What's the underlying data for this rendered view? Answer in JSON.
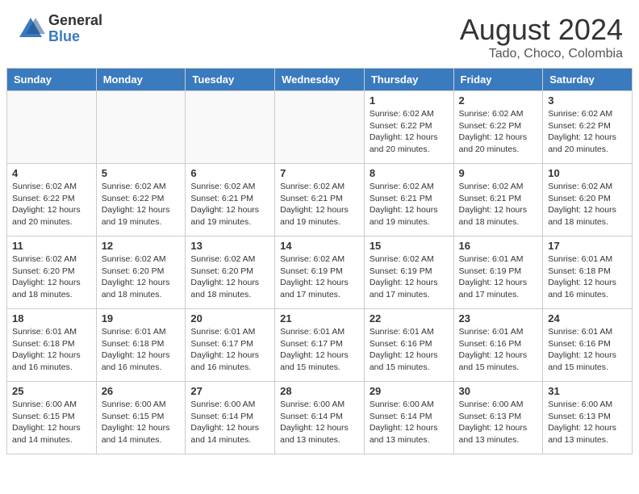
{
  "logo": {
    "general": "General",
    "blue": "Blue"
  },
  "header": {
    "month": "August 2024",
    "location": "Tado, Choco, Colombia"
  },
  "weekdays": [
    "Sunday",
    "Monday",
    "Tuesday",
    "Wednesday",
    "Thursday",
    "Friday",
    "Saturday"
  ],
  "weeks": [
    [
      {
        "day": "",
        "info": ""
      },
      {
        "day": "",
        "info": ""
      },
      {
        "day": "",
        "info": ""
      },
      {
        "day": "",
        "info": ""
      },
      {
        "day": "1",
        "info": "Sunrise: 6:02 AM\nSunset: 6:22 PM\nDaylight: 12 hours\nand 20 minutes."
      },
      {
        "day": "2",
        "info": "Sunrise: 6:02 AM\nSunset: 6:22 PM\nDaylight: 12 hours\nand 20 minutes."
      },
      {
        "day": "3",
        "info": "Sunrise: 6:02 AM\nSunset: 6:22 PM\nDaylight: 12 hours\nand 20 minutes."
      }
    ],
    [
      {
        "day": "4",
        "info": "Sunrise: 6:02 AM\nSunset: 6:22 PM\nDaylight: 12 hours\nand 20 minutes."
      },
      {
        "day": "5",
        "info": "Sunrise: 6:02 AM\nSunset: 6:22 PM\nDaylight: 12 hours\nand 19 minutes."
      },
      {
        "day": "6",
        "info": "Sunrise: 6:02 AM\nSunset: 6:21 PM\nDaylight: 12 hours\nand 19 minutes."
      },
      {
        "day": "7",
        "info": "Sunrise: 6:02 AM\nSunset: 6:21 PM\nDaylight: 12 hours\nand 19 minutes."
      },
      {
        "day": "8",
        "info": "Sunrise: 6:02 AM\nSunset: 6:21 PM\nDaylight: 12 hours\nand 19 minutes."
      },
      {
        "day": "9",
        "info": "Sunrise: 6:02 AM\nSunset: 6:21 PM\nDaylight: 12 hours\nand 18 minutes."
      },
      {
        "day": "10",
        "info": "Sunrise: 6:02 AM\nSunset: 6:20 PM\nDaylight: 12 hours\nand 18 minutes."
      }
    ],
    [
      {
        "day": "11",
        "info": "Sunrise: 6:02 AM\nSunset: 6:20 PM\nDaylight: 12 hours\nand 18 minutes."
      },
      {
        "day": "12",
        "info": "Sunrise: 6:02 AM\nSunset: 6:20 PM\nDaylight: 12 hours\nand 18 minutes."
      },
      {
        "day": "13",
        "info": "Sunrise: 6:02 AM\nSunset: 6:20 PM\nDaylight: 12 hours\nand 18 minutes."
      },
      {
        "day": "14",
        "info": "Sunrise: 6:02 AM\nSunset: 6:19 PM\nDaylight: 12 hours\nand 17 minutes."
      },
      {
        "day": "15",
        "info": "Sunrise: 6:02 AM\nSunset: 6:19 PM\nDaylight: 12 hours\nand 17 minutes."
      },
      {
        "day": "16",
        "info": "Sunrise: 6:01 AM\nSunset: 6:19 PM\nDaylight: 12 hours\nand 17 minutes."
      },
      {
        "day": "17",
        "info": "Sunrise: 6:01 AM\nSunset: 6:18 PM\nDaylight: 12 hours\nand 16 minutes."
      }
    ],
    [
      {
        "day": "18",
        "info": "Sunrise: 6:01 AM\nSunset: 6:18 PM\nDaylight: 12 hours\nand 16 minutes."
      },
      {
        "day": "19",
        "info": "Sunrise: 6:01 AM\nSunset: 6:18 PM\nDaylight: 12 hours\nand 16 minutes."
      },
      {
        "day": "20",
        "info": "Sunrise: 6:01 AM\nSunset: 6:17 PM\nDaylight: 12 hours\nand 16 minutes."
      },
      {
        "day": "21",
        "info": "Sunrise: 6:01 AM\nSunset: 6:17 PM\nDaylight: 12 hours\nand 15 minutes."
      },
      {
        "day": "22",
        "info": "Sunrise: 6:01 AM\nSunset: 6:16 PM\nDaylight: 12 hours\nand 15 minutes."
      },
      {
        "day": "23",
        "info": "Sunrise: 6:01 AM\nSunset: 6:16 PM\nDaylight: 12 hours\nand 15 minutes."
      },
      {
        "day": "24",
        "info": "Sunrise: 6:01 AM\nSunset: 6:16 PM\nDaylight: 12 hours\nand 15 minutes."
      }
    ],
    [
      {
        "day": "25",
        "info": "Sunrise: 6:00 AM\nSunset: 6:15 PM\nDaylight: 12 hours\nand 14 minutes."
      },
      {
        "day": "26",
        "info": "Sunrise: 6:00 AM\nSunset: 6:15 PM\nDaylight: 12 hours\nand 14 minutes."
      },
      {
        "day": "27",
        "info": "Sunrise: 6:00 AM\nSunset: 6:14 PM\nDaylight: 12 hours\nand 14 minutes."
      },
      {
        "day": "28",
        "info": "Sunrise: 6:00 AM\nSunset: 6:14 PM\nDaylight: 12 hours\nand 13 minutes."
      },
      {
        "day": "29",
        "info": "Sunrise: 6:00 AM\nSunset: 6:14 PM\nDaylight: 12 hours\nand 13 minutes."
      },
      {
        "day": "30",
        "info": "Sunrise: 6:00 AM\nSunset: 6:13 PM\nDaylight: 12 hours\nand 13 minutes."
      },
      {
        "day": "31",
        "info": "Sunrise: 6:00 AM\nSunset: 6:13 PM\nDaylight: 12 hours\nand 13 minutes."
      }
    ]
  ]
}
